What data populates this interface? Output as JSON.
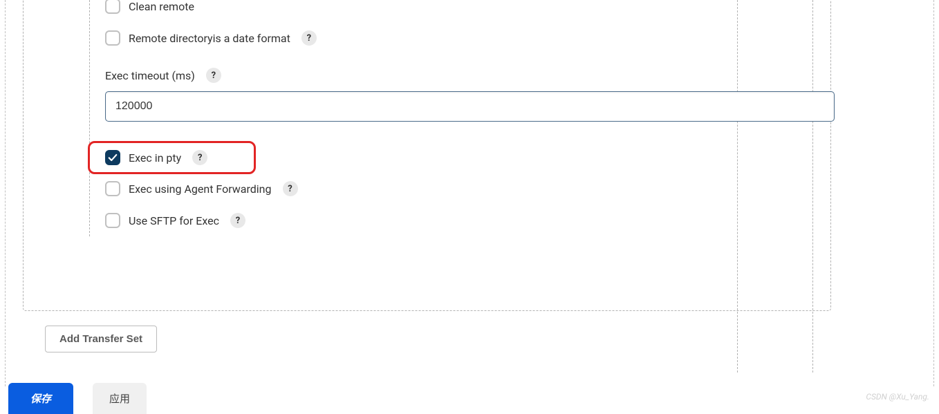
{
  "form": {
    "cleanRemote": {
      "label": "Clean remote",
      "checked": false
    },
    "remoteDirDateFormat": {
      "label": "Remote directoryis a date format",
      "checked": false
    },
    "execTimeout": {
      "label": "Exec timeout (ms)",
      "value": "120000"
    },
    "execInPty": {
      "label": "Exec in pty",
      "checked": true
    },
    "execAgentForwarding": {
      "label": "Exec using Agent Forwarding",
      "checked": false
    },
    "useSftpForExec": {
      "label": "Use SFTP for Exec",
      "checked": false
    }
  },
  "buttons": {
    "addTransferSet": "Add Transfer Set",
    "save": "保存",
    "apply": "应用"
  },
  "watermark": "CSDN @Xu_Yang."
}
